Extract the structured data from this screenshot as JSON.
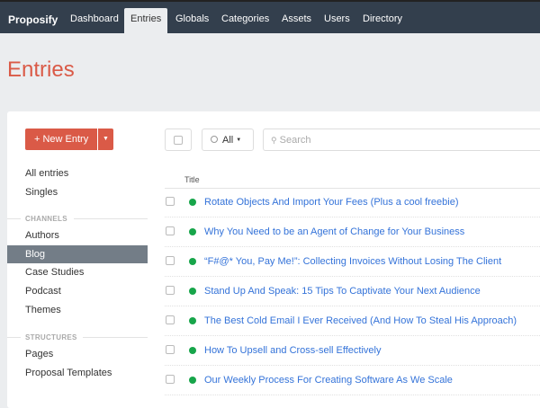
{
  "nav": {
    "brand": "Proposify",
    "tabs": [
      "Dashboard",
      "Entries",
      "Globals",
      "Categories",
      "Assets",
      "Users",
      "Directory"
    ]
  },
  "page_title": "Entries",
  "toolbar": {
    "new_entry": "+ New Entry",
    "filter": "All",
    "search_placeholder": "Search"
  },
  "sidebar": {
    "top": [
      "All entries",
      "Singles"
    ],
    "channels_heading": "CHANNELS",
    "channels": [
      "Authors",
      "Blog",
      "Case Studies",
      "Podcast",
      "Themes"
    ],
    "structures_heading": "STRUCTURES",
    "structures": [
      "Pages",
      "Proposal Templates"
    ]
  },
  "table": {
    "header": "Title",
    "rows": [
      "Rotate Objects And Import Your Fees (Plus a cool freebie)",
      "Why You Need to be an Agent of Change for Your Business",
      "“F#@* You, Pay Me!”: Collecting Invoices Without Losing The Client",
      "Stand Up And Speak: 15 Tips To Captivate Your Next Audience",
      "The Best Cold Email I Ever Received (And How To Steal His Approach)",
      "How To Upsell and Cross-sell Effectively",
      "Our Weekly Process For Creating Software As We Scale"
    ]
  }
}
